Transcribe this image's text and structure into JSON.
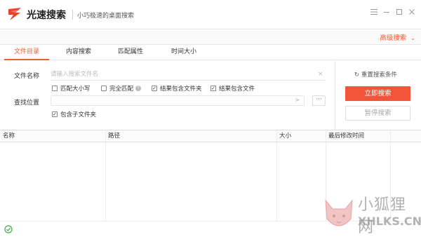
{
  "app": {
    "title": "光速搜索",
    "subtitle": "小巧极速的桌面搜索"
  },
  "window": {
    "menu_icon": "menu-icon",
    "minimize_icon": "minimize-icon",
    "maximize_icon": "maximize-icon",
    "close_icon": "close-icon"
  },
  "advanced": {
    "label": "高级搜索",
    "chevron": "⌄"
  },
  "tabs": [
    {
      "label": "文件目录",
      "active": true
    },
    {
      "label": "内容搜索",
      "active": false
    },
    {
      "label": "匹配属性",
      "active": false
    },
    {
      "label": "时间大小",
      "active": false
    }
  ],
  "form": {
    "filename_label": "文件名称",
    "filename_placeholder": "请输入搜索文件名",
    "clear_glyph": "×",
    "location_label": "查找位置",
    "location_value": "",
    "more_glyph": "···",
    "arrow_glyph": ">",
    "options": [
      {
        "label": "匹配大小写",
        "checked": false
      },
      {
        "label": "完全匹配",
        "checked": false
      },
      {
        "label": "结果包含文件夹",
        "checked": true
      },
      {
        "label": "结果包含文件",
        "checked": true
      }
    ],
    "include_sub": {
      "label": "包含子文件夹",
      "checked": true
    },
    "help_glyph": "?"
  },
  "actions": {
    "reset_label": "重置搜索条件",
    "reset_glyph": "↻",
    "search_label": "立即搜索",
    "pause_label": "暂停搜索"
  },
  "table": {
    "columns": [
      "名称",
      "路径",
      "大小",
      "最后修改时间"
    ],
    "rows": []
  },
  "watermark": {
    "line1": "小狐狸网",
    "line2": "XHLKS.CN"
  },
  "colors": {
    "accent": "#ee5a31",
    "button": "#f2553a",
    "status_ok": "#3cb043"
  }
}
